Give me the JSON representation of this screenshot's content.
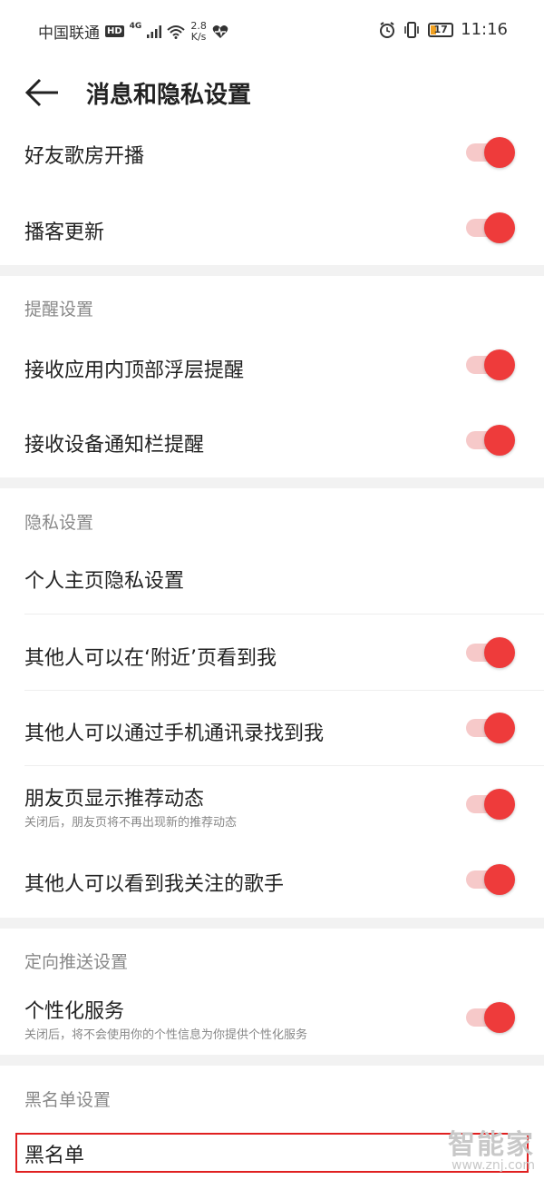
{
  "status_bar": {
    "carrier": "中国联通",
    "hd": "HD",
    "network": "4G",
    "speed_value": "2.8",
    "speed_unit": "K/s",
    "battery": "17",
    "time": "11:16"
  },
  "header": {
    "title": "消息和隐私设置"
  },
  "colors": {
    "accent": "#ee3b3b",
    "toggle_track": "#f6c9c9",
    "section_gap": "#f2f2f2",
    "secondary_text": "#888888",
    "highlight": "#e02020"
  },
  "rows": {
    "friend_room": {
      "label": "好友歌房开播",
      "on": true
    },
    "podcast_update": {
      "label": "播客更新",
      "on": true
    },
    "in_app_float": {
      "label": "接收应用内顶部浮层提醒",
      "on": true
    },
    "notification_bar": {
      "label": "接收设备通知栏提醒",
      "on": true
    },
    "homepage_privacy": {
      "label": "个人主页隐私设置"
    },
    "nearby_visible": {
      "label": "其他人可以在‘附近’页看到我",
      "on": true
    },
    "contacts_find": {
      "label": "其他人可以通过手机通讯录找到我",
      "on": true
    },
    "friend_recommend": {
      "label": "朋友页显示推荐动态",
      "sub": "关闭后，朋友页将不再出现新的推荐动态",
      "on": true
    },
    "followed_singers": {
      "label": "其他人可以看到我关注的歌手",
      "on": true
    },
    "personalized": {
      "label": "个性化服务",
      "sub": "关闭后，将不会使用你的个性信息为你提供个性化服务",
      "on": true
    },
    "blacklist": {
      "label": "黑名单"
    }
  },
  "sections": {
    "reminder": "提醒设置",
    "privacy": "隐私设置",
    "targeted_push": "定向推送设置",
    "blacklist": "黑名单设置"
  },
  "watermark": {
    "main": "智能家",
    "sub": "www.znj.com"
  }
}
